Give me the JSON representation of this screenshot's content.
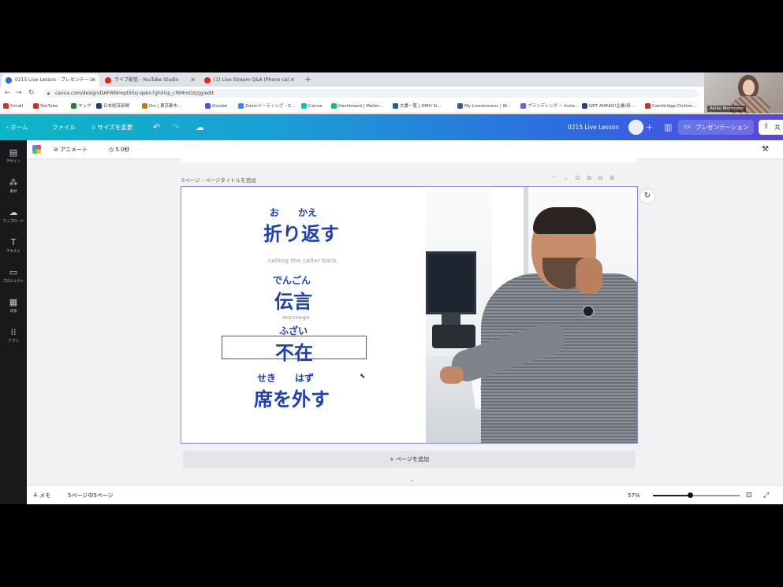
{
  "browser": {
    "tabs": [
      {
        "label": "0215 Live Lesson - プレゼンテーシ",
        "favicon_color": "#2a6ae0",
        "active": true
      },
      {
        "label": "ライブ配信 - YouTube Studio",
        "favicon_color": "#e2231a",
        "active": false
      },
      {
        "label": "(1) Live Stream Q&A (Phone cal",
        "favicon_color": "#e2231a",
        "active": false
      }
    ],
    "url": "canva.com/design/DAFWNmqd35s/-qekn7gh0Gp_cf6MmOzjzjg/edit",
    "bookmarks": [
      {
        "label": "Gmail",
        "color": "#d93025"
      },
      {
        "label": "YouTube",
        "color": "#e2231a"
      },
      {
        "label": "マップ",
        "color": "#188038"
      },
      {
        "label": "日本経済新聞",
        "color": "#1a3d7c"
      },
      {
        "label": "Dci | 東京都市...",
        "color": "#c47a13"
      },
      {
        "label": "Quizlet",
        "color": "#4255ff"
      },
      {
        "label": "Zoomミーティング - Z...",
        "color": "#2d8cff"
      },
      {
        "label": "Canva",
        "color": "#00c4cc"
      },
      {
        "label": "Dashboard | Mailer...",
        "color": "#09c269"
      },
      {
        "label": "文書一覧 | DMO Si...",
        "color": "#1b5fa7"
      },
      {
        "label": "My Livestreams | W...",
        "color": "#3b5998"
      },
      {
        "label": "ブランディング ~ Insta...",
        "color": "#6c5ce7"
      },
      {
        "label": "GET AHEAD!企業/研...",
        "color": "#2b3a8f"
      },
      {
        "label": "Cambridge Diction...",
        "color": "#c0392b"
      }
    ],
    "webcam_name": "Akiko Morimoto"
  },
  "canva_header": {
    "home": "ホーム",
    "file": "ファイル",
    "resize": "サイズを変更",
    "design_title": "0215 Live Lesson",
    "present": "プレゼンテーション",
    "share": "共"
  },
  "sidebar": {
    "items": [
      {
        "icon": "layout-icon",
        "glyph": "▤",
        "label": "デザイン"
      },
      {
        "icon": "elements-icon",
        "glyph": "⁂",
        "label": "素材"
      },
      {
        "icon": "upload-icon",
        "glyph": "☁",
        "label": "アップロード"
      },
      {
        "icon": "text-icon",
        "glyph": "T",
        "label": "テキスト"
      },
      {
        "icon": "folder-icon",
        "glyph": "▭",
        "label": "プロジェクト"
      },
      {
        "icon": "background-icon",
        "glyph": "▦",
        "label": "背景"
      },
      {
        "icon": "apps-icon",
        "glyph": "⁞⁞",
        "label": "アプリ"
      }
    ]
  },
  "toolbar": {
    "animate": "アニメート",
    "duration": "5.0秒"
  },
  "page": {
    "header": "5ページ - ページタイトルを追加",
    "words": [
      {
        "ruby": "お　　かえ",
        "kanji": "折り返す"
      },
      {
        "english": "calling the caller back"
      },
      {
        "ruby": "でんごん",
        "kanji": "伝言"
      },
      {
        "english": "message"
      },
      {
        "ruby": "ふざい",
        "kanji": "不在"
      },
      {
        "ruby": "せき　　はず",
        "kanji": "席を外す"
      }
    ],
    "add_page": "+ ページを追加"
  },
  "footer": {
    "notes": "メモ",
    "page_count": "5ページ中5ページ",
    "zoom": "57%",
    "zoom_fraction": 0.43
  },
  "colors": {
    "text_blue": "#1c3fb5",
    "selection": "#8b7fd8"
  }
}
